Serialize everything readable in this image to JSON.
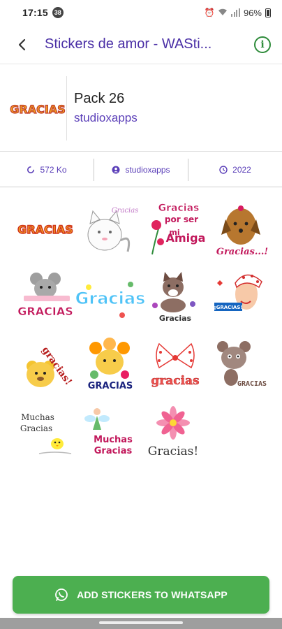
{
  "status_bar": {
    "time": "17:15",
    "notification_count": "38",
    "battery_percent": "96%"
  },
  "app_bar": {
    "title": "Stickers de amor - WASti..."
  },
  "pack": {
    "name": "Pack 26",
    "author": "studioxapps",
    "tray_label": "GRACIAS"
  },
  "stats": {
    "size": "572 Ko",
    "publisher": "studioxapps",
    "year": "2022"
  },
  "stickers": [
    {
      "name": "gracias-orange-text",
      "texts": [
        "GRACIAS"
      ]
    },
    {
      "name": "white-cat-gracias",
      "texts": [
        "Gracias"
      ]
    },
    {
      "name": "gracias-por-ser-mi-amiga",
      "texts": [
        "Gracias",
        "por ser",
        "mi",
        "Amiga"
      ]
    },
    {
      "name": "yorkie-dog-gracias",
      "texts": [
        "Gracias...!"
      ]
    },
    {
      "name": "mouse-gracias",
      "texts": [
        "GRACIAS"
      ]
    },
    {
      "name": "colorful-gracias-letters",
      "texts": [
        "Gracias"
      ]
    },
    {
      "name": "kitten-flowers-gracias",
      "texts": [
        "Gracias"
      ]
    },
    {
      "name": "polka-woman-gracias",
      "texts": [
        "¡GRACIAS!"
      ]
    },
    {
      "name": "bear-gracias",
      "texts": [
        "gracias!"
      ]
    },
    {
      "name": "flower-bear-gracias",
      "texts": [
        "GRACIAS"
      ]
    },
    {
      "name": "polka-bow-gracias",
      "texts": [
        "gracias"
      ]
    },
    {
      "name": "brown-bear-gracias",
      "texts": [
        "GRACIAS"
      ]
    },
    {
      "name": "chick-muchas-gracias",
      "texts": [
        "Muchas",
        "Gracias"
      ]
    },
    {
      "name": "fairy-muchas-gracias",
      "texts": [
        "Muchas",
        "Gracias"
      ]
    },
    {
      "name": "pink-flower-gracias",
      "texts": [
        "Gracias!"
      ]
    }
  ],
  "actions": {
    "add_button_label": "ADD STICKERS TO WHATSAPP"
  },
  "colors": {
    "title_purple": "#4a2fa6",
    "author_purple": "#5a3eb8",
    "button_green": "#4caf50",
    "info_green": "#2e8b3a"
  }
}
